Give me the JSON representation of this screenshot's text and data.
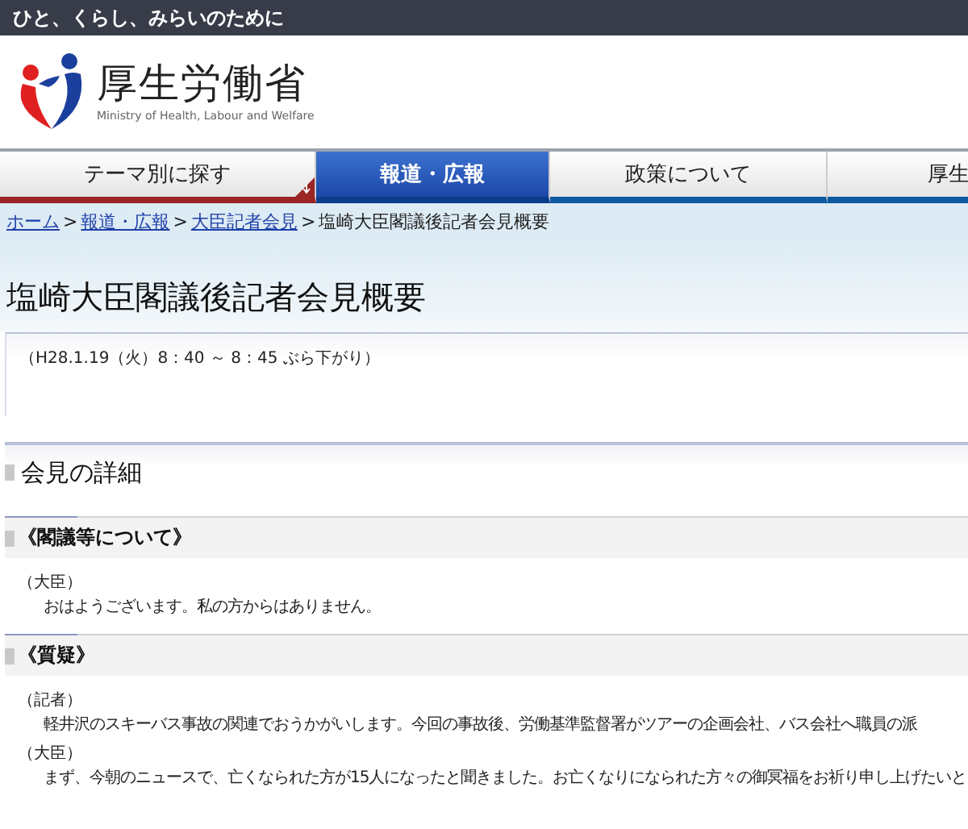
{
  "tagline": "ひと、くらし、みらいのために",
  "logo": {
    "name": "厚生労働省",
    "subtitle": "Ministry of Health, Labour and Welfare"
  },
  "nav": [
    {
      "label": "テーマ別に探す",
      "selected": false
    },
    {
      "label": "報道・広報",
      "selected": true
    },
    {
      "label": "政策について",
      "selected": false
    },
    {
      "label": "厚生",
      "selected": false
    }
  ],
  "breadcrumb": [
    {
      "label": "ホーム",
      "link": true
    },
    {
      "separator": ">",
      "label": "報道・広報",
      "link": true
    },
    {
      "separator": ">",
      "label": "大臣記者会見",
      "link": true
    },
    {
      "separator": ">",
      "label": "塩崎大臣閣議後記者会見概要",
      "link": false
    }
  ],
  "title": "塩崎大臣閣議後記者会見概要",
  "date": "（H28.1.19（火）8：40 ～ 8：45 ぶら下がり）",
  "section": "会見の詳細",
  "topics": [
    {
      "heading": "《閣議等について》",
      "entries": [
        {
          "speaker": "（大臣）",
          "text": "おはようございます。私の方からはありません。"
        }
      ]
    },
    {
      "heading": "《質疑》",
      "entries": [
        {
          "speaker": "（記者）",
          "text": "軽井沢のスキーバス事故の関連でおうかがいします。今回の事故後、労働基準監督署がツアーの企画会社、バス会社へ職員の派"
        },
        {
          "speaker": "（大臣）",
          "text": "まず、今朝のニュースで、亡くなられた方が15人になったと聞きました。お亡くなりになられた方々の御冥福をお祈り申し上げたいと"
        }
      ]
    }
  ]
}
